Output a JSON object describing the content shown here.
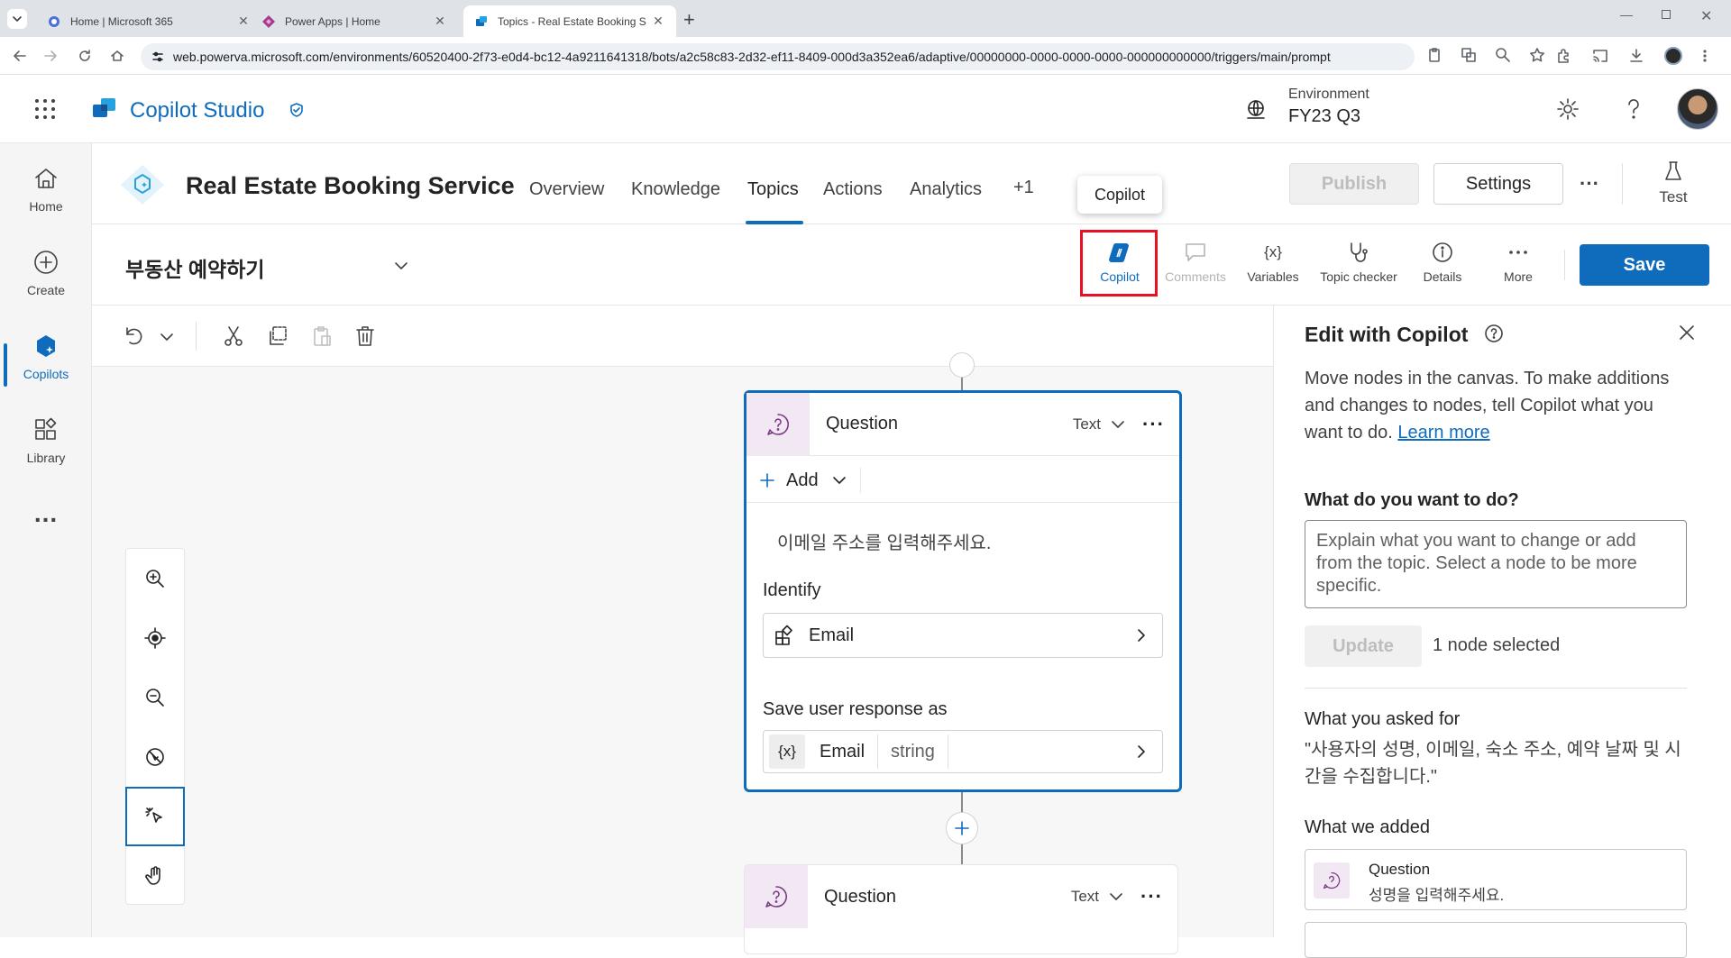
{
  "browser": {
    "tabs": [
      {
        "title": "Home | Microsoft 365",
        "active": false
      },
      {
        "title": "Power Apps | Home",
        "active": false
      },
      {
        "title": "Topics - Real Estate Booking S",
        "active": true
      }
    ],
    "url": "web.powerva.microsoft.com/environments/60520400-2f73-e0d4-bc12-4a9211641318/bots/a2c58c83-2d32-ef11-8409-000d3a352ea6/adaptive/00000000-0000-0000-0000-000000000000/triggers/main/prompt"
  },
  "app": {
    "name": "Copilot Studio",
    "environment_label": "Environment",
    "environment_value": "FY23 Q3"
  },
  "rail": {
    "items": [
      {
        "label": "Home"
      },
      {
        "label": "Create"
      },
      {
        "label": "Copilots"
      },
      {
        "label": "Library"
      }
    ],
    "more": "..."
  },
  "bot": {
    "name": "Real Estate Booking Service",
    "tabs": [
      "Overview",
      "Knowledge",
      "Topics",
      "Actions",
      "Analytics",
      "+1"
    ],
    "active_tab": "Topics",
    "publish_label": "Publish",
    "settings_label": "Settings",
    "more_label": "···",
    "test_label": "Test"
  },
  "tooltip": {
    "text": "Copilot"
  },
  "topic": {
    "name": "부동산 예약하기",
    "toolbar": {
      "copilot": "Copilot",
      "comments": "Comments",
      "variables": "Variables",
      "topic_checker": "Topic checker",
      "details": "Details",
      "more": "More",
      "save": "Save"
    }
  },
  "canvas": {
    "node1": {
      "title": "Question",
      "type": "Text",
      "add_label": "Add",
      "message": "이메일 주소를 입력해주세요.",
      "identify_label": "Identify",
      "identify_value": "Email",
      "save_label": "Save user response as",
      "var_icon": "{x}",
      "var_name": "Email",
      "var_type": "string"
    },
    "node2": {
      "title": "Question",
      "type": "Text"
    }
  },
  "panel": {
    "title": "Edit with Copilot",
    "intro": "Move nodes in the canvas. To make additions and changes to nodes, tell Copilot what you want to do.",
    "learn_more": "Learn more",
    "question_label": "What do you want to do?",
    "placeholder": "Explain what you want to change or add from the topic. Select a node to be more specific.",
    "update_label": "Update",
    "selected_text": "1 node selected",
    "asked_label": "What you asked for",
    "asked_text": "\"사용자의 성명, 이메일, 숙소 주소, 예약 날짜 및 시간을 수집합니다.\"",
    "added_label": "What we added",
    "added_item_title": "Question",
    "added_item_text": "성명을 입력해주세요."
  },
  "colors": {
    "accent": "#0f6cbd",
    "highlight_box": "#e81123",
    "node_icon_bg": "#f1e8f3"
  }
}
